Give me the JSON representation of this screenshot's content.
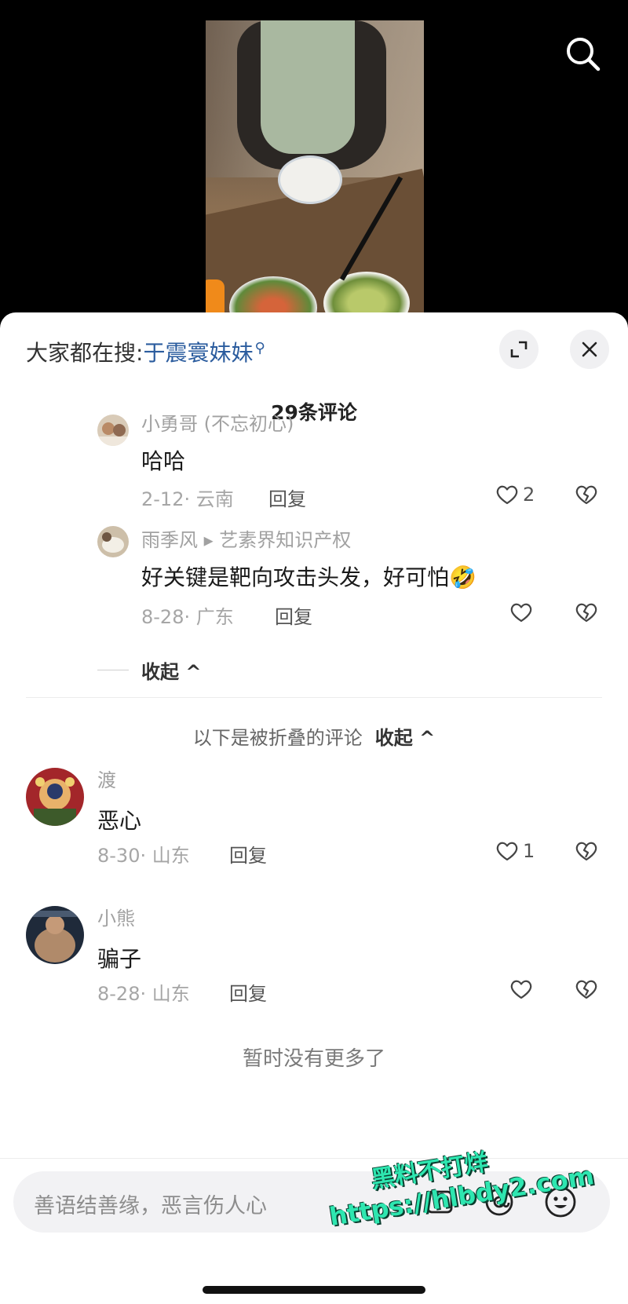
{
  "hot_search": {
    "prefix": "大家都在搜:",
    "term": "于震寰妹妹",
    "mag_glyph": "⚲"
  },
  "comments_count": "29条评论",
  "replies": [
    {
      "name": "小勇哥 (不忘初心)",
      "text": "哈哈",
      "meta": "2-12· 云南",
      "reply_label": "回复",
      "likes": "2"
    },
    {
      "name": "雨季风 ▸ 艺素界知识产权",
      "text": "好关键是靶向攻击头发，好可怕🤣",
      "meta": "8-28· 广东",
      "reply_label": "回复",
      "likes": ""
    }
  ],
  "collapse_label": "收起 ^",
  "folded": {
    "label": "以下是被折叠的评论",
    "action": "收起 ^"
  },
  "comments": [
    {
      "name": "渡",
      "text": "恶心",
      "meta": "8-30· 山东",
      "reply_label": "回复",
      "likes": "1"
    },
    {
      "name": "小熊",
      "text": "骗子",
      "meta": "8-28· 山东",
      "reply_label": "回复",
      "likes": ""
    }
  ],
  "no_more": "暂时没有更多了",
  "input": {
    "placeholder": "善语结善缘，恶言伤人心"
  },
  "watermark": {
    "line1": "黑料不打烊",
    "line2": "https://hlbdy2.com"
  },
  "colors": {
    "accent_link": "#2b5c9e",
    "watermark": "#2ee6b0"
  }
}
